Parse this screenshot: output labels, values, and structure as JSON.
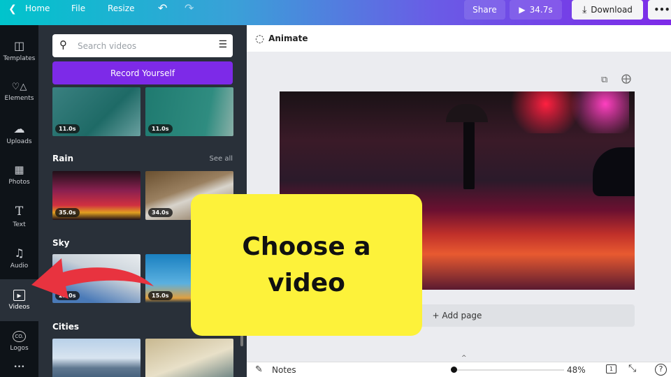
{
  "topbar": {
    "home": "Home",
    "file": "File",
    "resize": "Resize",
    "share": "Share",
    "play_duration": "34.7s",
    "download": "Download",
    "more": "•••"
  },
  "sidebar": {
    "items": [
      {
        "label": "Templates",
        "icon": "templates-icon"
      },
      {
        "label": "Elements",
        "icon": "elements-icon"
      },
      {
        "label": "Uploads",
        "icon": "upload-cloud-icon"
      },
      {
        "label": "Photos",
        "icon": "image-icon"
      },
      {
        "label": "Text",
        "icon": "text-icon"
      },
      {
        "label": "Audio",
        "icon": "music-note-icon"
      },
      {
        "label": "Videos",
        "icon": "video-icon",
        "active": true
      },
      {
        "label": "Logos",
        "icon": "logo-icon"
      }
    ],
    "more": "•••"
  },
  "panel": {
    "search_placeholder": "Search videos",
    "record_label": "Record Yourself",
    "see_all": "See all",
    "top_durations": [
      "11.0s",
      "11.0s"
    ],
    "sections": [
      {
        "title": "Rain",
        "durations": [
          "35.0s",
          "34.0s"
        ]
      },
      {
        "title": "Sky",
        "durations": [
          "23.0s",
          "15.0s"
        ]
      },
      {
        "title": "Cities",
        "durations": []
      }
    ]
  },
  "canvas": {
    "animate": "Animate",
    "add_page": "+ Add page"
  },
  "bottom": {
    "notes": "Notes",
    "zoom": "48%",
    "page": "1",
    "zoom_level_percent": 48
  },
  "callout": {
    "text": "Choose a video",
    "color": "#fdf23a",
    "arrow_color": "#e8333f"
  },
  "colors": {
    "accent": "#7d2ae8",
    "topbar_start": "#00c4cc"
  }
}
